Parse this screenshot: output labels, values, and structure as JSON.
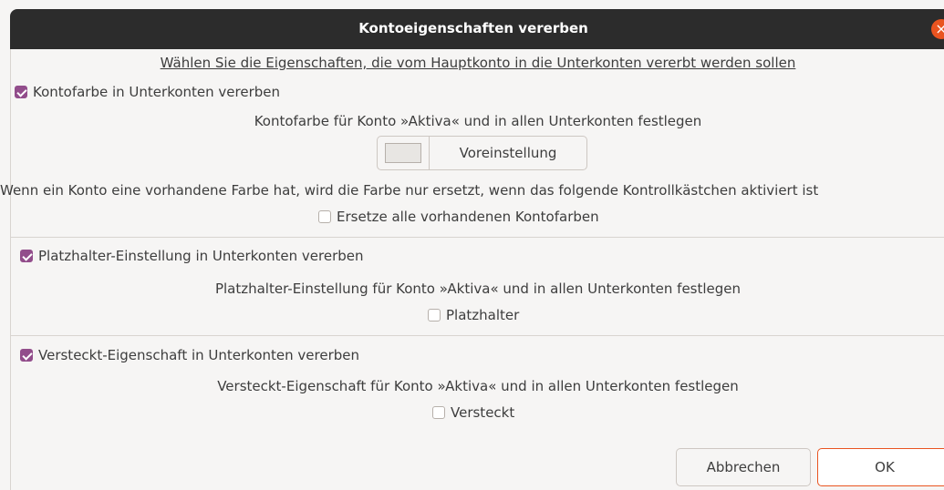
{
  "window": {
    "title": "Kontoeigenschaften vererben",
    "close_symbol": "×"
  },
  "instruction": "Wählen Sie die Eigenschaften, die vom Hauptkonto in die Unterkonten vererbt werden sollen",
  "color_section": {
    "checkbox_label": "Kontofarbe in Unterkonten vererben",
    "checked": true,
    "description": "Kontofarbe für Konto »Aktiva« und in allen Unterkonten festlegen",
    "default_button": "Voreinstellung",
    "note": "Wenn ein Konto eine vorhandene Farbe hat, wird die Farbe nur ersetzt, wenn das folgende Kontrollkästchen aktiviert ist",
    "replace_label": "Ersetze alle vorhandenen Kontofarben",
    "replace_checked": false
  },
  "placeholder_section": {
    "checkbox_label": "Platzhalter-Einstellung in Unterkonten vererben",
    "checked": true,
    "description": "Platzhalter-Einstellung für Konto »Aktiva« und in allen Unterkonten festlegen",
    "option_label": "Platzhalter",
    "option_checked": false
  },
  "hidden_section": {
    "checkbox_label": "Versteckt-Eigenschaft in Unterkonten vererben",
    "checked": true,
    "description": "Versteckt-Eigenschaft für Konto »Aktiva« und in allen Unterkonten festlegen",
    "option_label": "Versteckt",
    "option_checked": false
  },
  "buttons": {
    "cancel": "Abbrechen",
    "ok": "OK"
  },
  "colors": {
    "accent": "#924d8b",
    "close": "#e95420",
    "titlebar": "#2c2c2c"
  }
}
